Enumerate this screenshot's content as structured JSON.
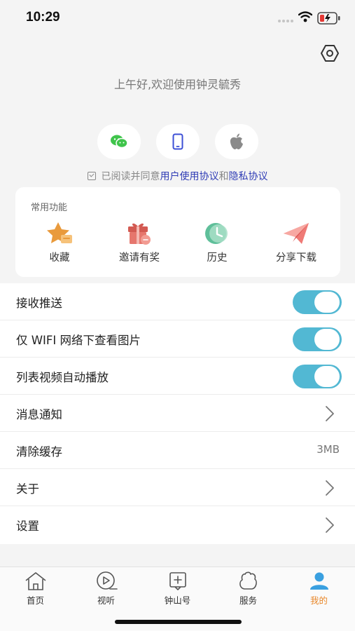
{
  "status_bar": {
    "time": "10:29"
  },
  "greeting": "上午好,欢迎使用钟灵毓秀",
  "agreement": {
    "prefix": "已阅读并同意",
    "user_agreement": "用户使用协议",
    "conjunction": "和",
    "privacy_policy": "隐私协议"
  },
  "login_options": [
    "wechat-icon",
    "phone-icon",
    "apple-icon"
  ],
  "common_functions": {
    "title": "常用功能",
    "items": [
      {
        "label": "收藏",
        "icon": "favorites-icon"
      },
      {
        "label": "邀请有奖",
        "icon": "gift-icon"
      },
      {
        "label": "历史",
        "icon": "history-icon"
      },
      {
        "label": "分享下载",
        "icon": "paper-plane-icon"
      }
    ]
  },
  "settings": [
    {
      "label": "接收推送",
      "type": "toggle",
      "on": true
    },
    {
      "label": "仅 WIFI 网络下查看图片",
      "type": "toggle",
      "on": true
    },
    {
      "label": "列表视频自动播放",
      "type": "toggle",
      "on": true
    },
    {
      "label": "消息通知",
      "type": "link"
    },
    {
      "label": "清除缓存",
      "type": "value",
      "value": "3MB"
    },
    {
      "label": "关于",
      "type": "link"
    },
    {
      "label": "设置",
      "type": "link"
    }
  ],
  "tabs": [
    {
      "label": "首页",
      "icon": "home-icon"
    },
    {
      "label": "视听",
      "icon": "play-icon"
    },
    {
      "label": "钟山号",
      "icon": "add-post-icon"
    },
    {
      "label": "服务",
      "icon": "service-icon"
    },
    {
      "label": "我的",
      "icon": "profile-icon",
      "active": true
    }
  ],
  "colors": {
    "accent": "#52b8d3",
    "link": "#2f3cb5",
    "active_tab": "#e8872a"
  }
}
